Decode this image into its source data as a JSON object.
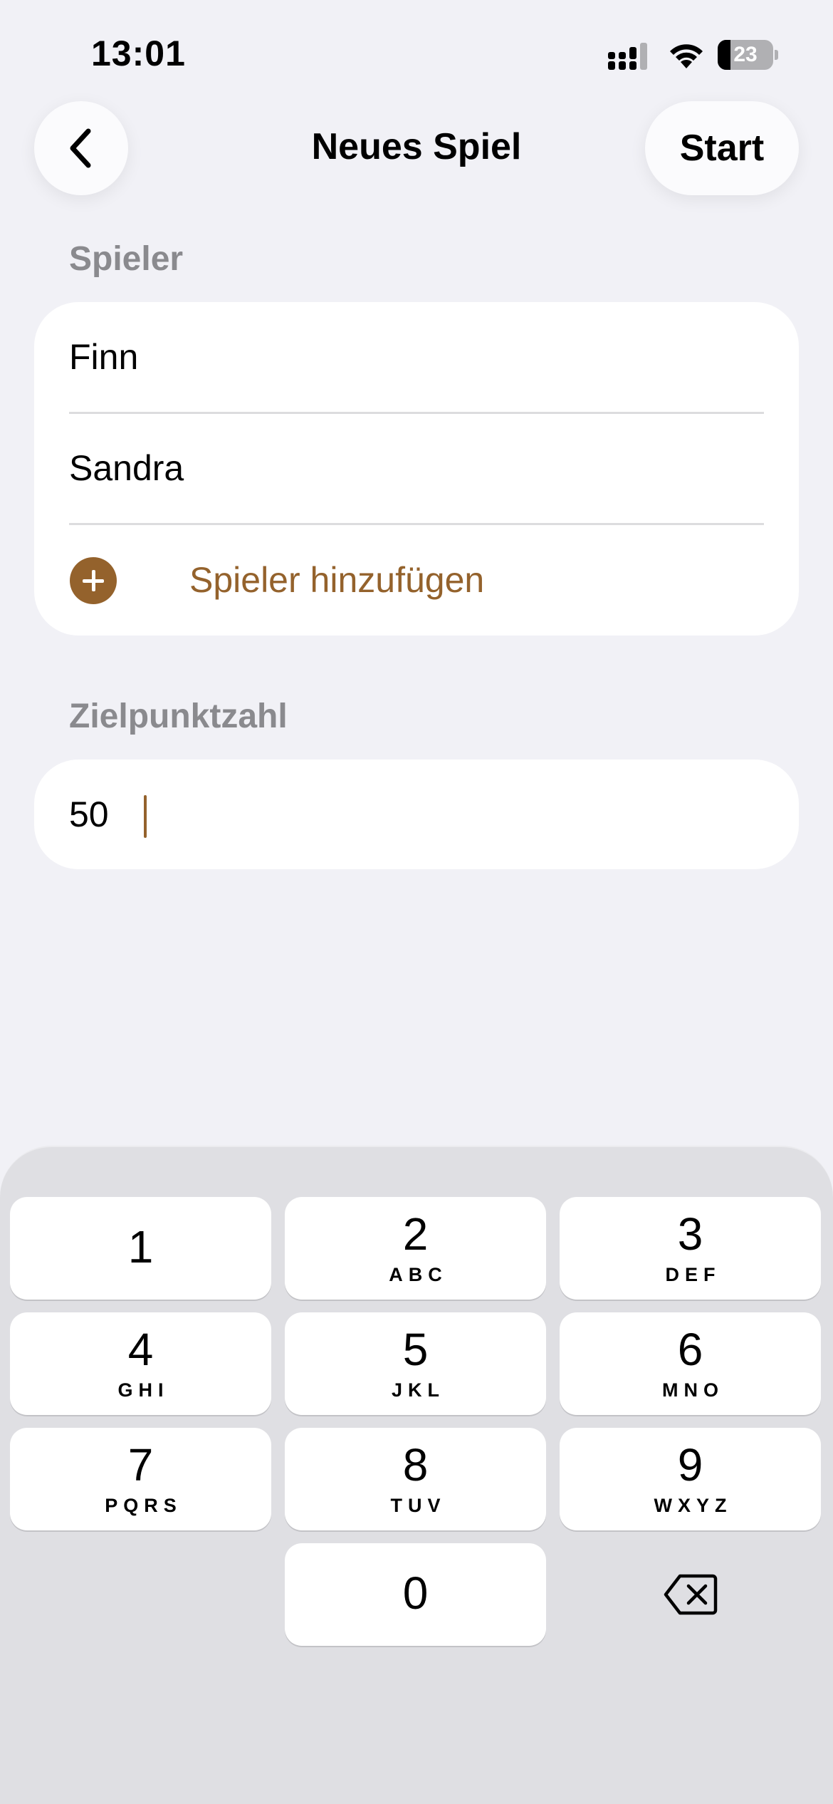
{
  "status_bar": {
    "time": "13:01",
    "battery_level": "23",
    "battery_fraction": 0.23,
    "icons": [
      "signal-icon",
      "wifi-icon",
      "battery-icon"
    ]
  },
  "nav": {
    "back_icon": "chevron-left-icon",
    "title": "Neues Spiel",
    "start_label": "Start"
  },
  "players_section": {
    "label": "Spieler",
    "players": [
      "Finn",
      "Sandra"
    ],
    "add_label": "Spieler hinzufügen",
    "add_icon": "plus-circle-icon"
  },
  "target_section": {
    "label": "Zielpunktzahl",
    "value": "50"
  },
  "keyboard": {
    "keys": [
      {
        "digit": "1",
        "letters": ""
      },
      {
        "digit": "2",
        "letters": "ABC"
      },
      {
        "digit": "3",
        "letters": "DEF"
      },
      {
        "digit": "4",
        "letters": "GHI"
      },
      {
        "digit": "5",
        "letters": "JKL"
      },
      {
        "digit": "6",
        "letters": "MNO"
      },
      {
        "digit": "7",
        "letters": "PQRS"
      },
      {
        "digit": "8",
        "letters": "TUV"
      },
      {
        "digit": "9",
        "letters": "WXYZ"
      },
      {
        "digit": "0",
        "letters": ""
      }
    ],
    "delete_icon": "delete-backspace-icon"
  },
  "colors": {
    "accent": "#94622c",
    "background": "#f1f1f6",
    "section_label": "#8a8a8e",
    "keyboard_bg": "#dfdfe3"
  }
}
